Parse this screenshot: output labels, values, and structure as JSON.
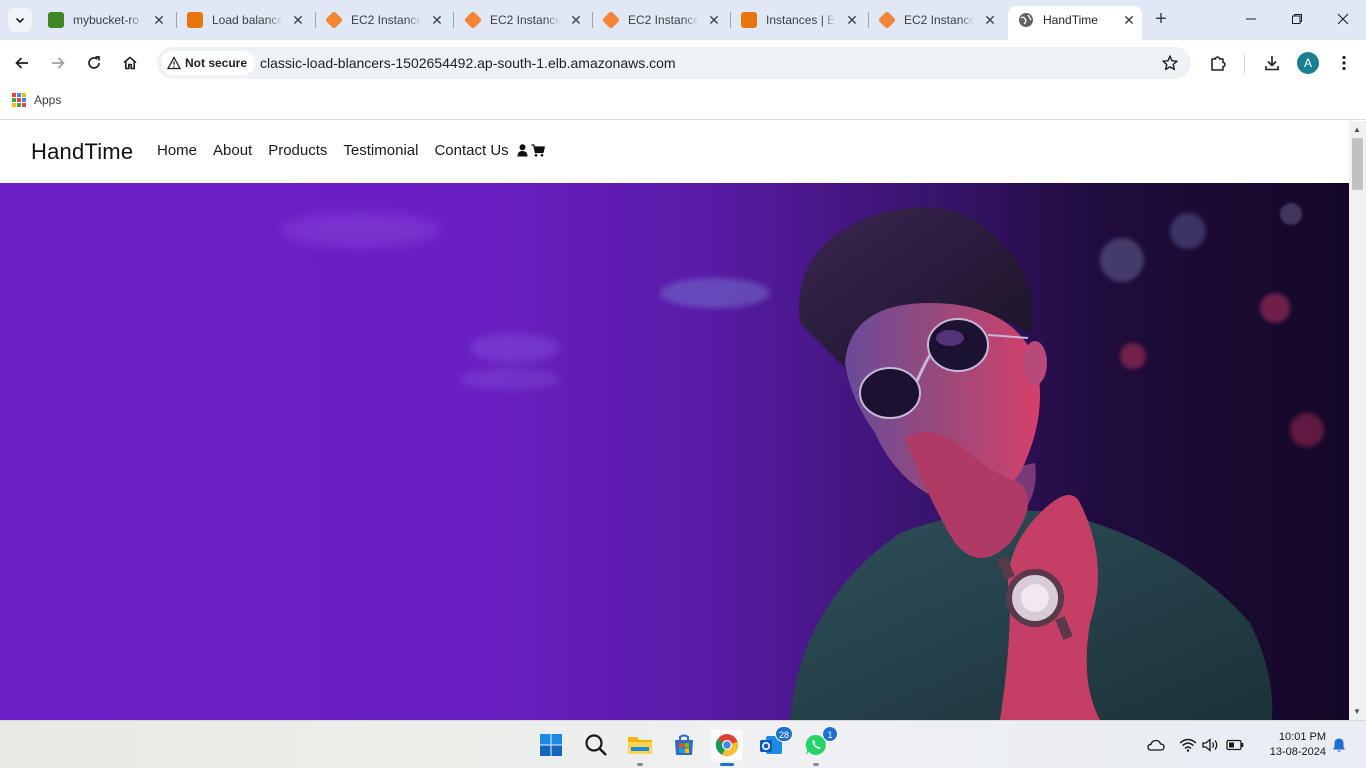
{
  "browser": {
    "tabs": [
      {
        "title": "mybucket-ro",
        "favicon_color": "#3f8624"
      },
      {
        "title": "Load balance",
        "favicon_color": "#e8740c"
      },
      {
        "title": "EC2 Instance",
        "favicon_color": "#f58536"
      },
      {
        "title": "EC2 Instance",
        "favicon_color": "#f58536"
      },
      {
        "title": "EC2 Instance",
        "favicon_color": "#f58536"
      },
      {
        "title": "Instances | E",
        "favicon_color": "#e8740c"
      },
      {
        "title": "EC2 Instance",
        "favicon_color": "#f58536"
      },
      {
        "title": "HandTime",
        "favicon_color": "#5f6368",
        "active": true
      }
    ],
    "close_glyph": "✕",
    "new_tab_glyph": "+",
    "security_chip": "Not secure",
    "url": "classic-load-blancers-1502654492.ap-south-1.elb.amazonaws.com",
    "profile_initial": "A",
    "bookmarks": {
      "apps_label": "Apps"
    }
  },
  "site": {
    "brand": "HandTime",
    "nav": [
      "Home",
      "About",
      "Products",
      "Testimonial",
      "Contact Us"
    ],
    "nav_icons": [
      "user-icon",
      "cart-icon"
    ]
  },
  "taskbar": {
    "apps": [
      {
        "name": "start",
        "icon": "windows-icon"
      },
      {
        "name": "search",
        "icon": "search-icon"
      },
      {
        "name": "file-explorer",
        "icon": "folder-icon"
      },
      {
        "name": "store",
        "icon": "store-icon"
      },
      {
        "name": "chrome",
        "icon": "chrome-icon",
        "active": true
      },
      {
        "name": "outlook",
        "icon": "mail-icon",
        "badge": "28"
      },
      {
        "name": "whatsapp",
        "icon": "whatsapp-icon",
        "badge": "1"
      }
    ],
    "time": "10:01 PM",
    "date": "13-08-2024"
  },
  "colors": {
    "hero_purple": "#6c1fc6",
    "tab_strip": "#dfe8f4",
    "omnibox": "#eef2f7",
    "badge_blue": "#1f6fd1"
  }
}
